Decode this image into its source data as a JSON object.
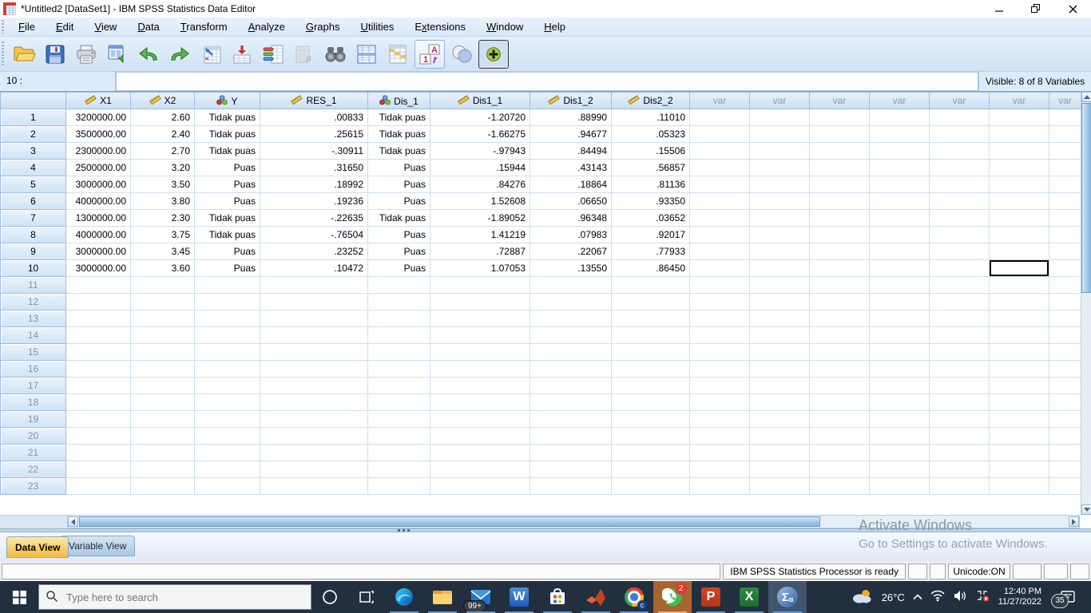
{
  "window": {
    "title": "*Untitled2 [DataSet1] - IBM SPSS Statistics Data Editor"
  },
  "menu": {
    "items": [
      {
        "label": "File",
        "mnemonic": 0
      },
      {
        "label": "Edit",
        "mnemonic": 0
      },
      {
        "label": "View",
        "mnemonic": 0
      },
      {
        "label": "Data",
        "mnemonic": 0
      },
      {
        "label": "Transform",
        "mnemonic": 0
      },
      {
        "label": "Analyze",
        "mnemonic": 0
      },
      {
        "label": "Graphs",
        "mnemonic": 0
      },
      {
        "label": "Utilities",
        "mnemonic": 0
      },
      {
        "label": "Extensions",
        "mnemonic": 1
      },
      {
        "label": "Window",
        "mnemonic": 0
      },
      {
        "label": "Help",
        "mnemonic": 0
      }
    ]
  },
  "toolbar": {
    "buttons": [
      {
        "name": "open-file-icon"
      },
      {
        "name": "save-icon"
      },
      {
        "name": "print-icon"
      },
      {
        "name": "recall-dialogs-icon"
      },
      {
        "name": "undo-icon"
      },
      {
        "name": "redo-icon"
      },
      {
        "name": "goto-case-icon"
      },
      {
        "name": "goto-variable-icon"
      },
      {
        "name": "variables-icon"
      },
      {
        "name": "descriptives-icon",
        "disabled": true
      },
      {
        "name": "find-icon"
      },
      {
        "name": "split-file-icon"
      },
      {
        "name": "select-cases-icon"
      },
      {
        "name": "value-labels-icon",
        "framed": true
      },
      {
        "name": "use-variable-sets-icon"
      },
      {
        "name": "show-all-variables-icon",
        "pressed": true
      }
    ]
  },
  "cell_reference": {
    "row_label": "10 :",
    "editor_value": "",
    "visible_info": "Visible: 8 of 8 Variables"
  },
  "grid": {
    "var_placeholder": "var",
    "columns": [
      {
        "name": "X1",
        "measure": "scale"
      },
      {
        "name": "X2",
        "measure": "scale"
      },
      {
        "name": "Y",
        "measure": "nominal"
      },
      {
        "name": "RES_1",
        "measure": "scale"
      },
      {
        "name": "Dis_1",
        "measure": "nominal"
      },
      {
        "name": "Dis1_1",
        "measure": "scale"
      },
      {
        "name": "Dis1_2",
        "measure": "scale"
      },
      {
        "name": "Dis2_2",
        "measure": "scale"
      }
    ],
    "rows": [
      {
        "n": "1",
        "values": [
          "3200000.00",
          "2.60",
          "Tidak puas",
          ".00833",
          "Tidak puas",
          "-1.20720",
          ".88990",
          ".11010"
        ]
      },
      {
        "n": "2",
        "values": [
          "3500000.00",
          "2.40",
          "Tidak puas",
          ".25615",
          "Tidak puas",
          "-1.66275",
          ".94677",
          ".05323"
        ]
      },
      {
        "n": "3",
        "values": [
          "2300000.00",
          "2.70",
          "Tidak puas",
          "-.30911",
          "Tidak puas",
          "-.97943",
          ".84494",
          ".15506"
        ]
      },
      {
        "n": "4",
        "values": [
          "2500000.00",
          "3.20",
          "Puas",
          ".31650",
          "Puas",
          ".15944",
          ".43143",
          ".56857"
        ]
      },
      {
        "n": "5",
        "values": [
          "3000000.00",
          "3.50",
          "Puas",
          ".18992",
          "Puas",
          ".84276",
          ".18864",
          ".81136"
        ]
      },
      {
        "n": "6",
        "values": [
          "4000000.00",
          "3.80",
          "Puas",
          ".19236",
          "Puas",
          "1.52608",
          ".06650",
          ".93350"
        ]
      },
      {
        "n": "7",
        "values": [
          "1300000.00",
          "2.30",
          "Tidak puas",
          "-.22635",
          "Tidak puas",
          "-1.89052",
          ".96348",
          ".03652"
        ]
      },
      {
        "n": "8",
        "values": [
          "4000000.00",
          "3.75",
          "Tidak puas",
          "-.76504",
          "Puas",
          "1.41219",
          ".07983",
          ".92017"
        ]
      },
      {
        "n": "9",
        "values": [
          "3000000.00",
          "3.45",
          "Puas",
          ".23252",
          "Puas",
          ".72887",
          ".22067",
          ".77933"
        ]
      },
      {
        "n": "10",
        "values": [
          "3000000.00",
          "3.60",
          "Puas",
          ".10472",
          "Puas",
          "1.07053",
          ".13550",
          ".86450"
        ]
      }
    ],
    "empty_row_start": 11,
    "empty_row_end": 23,
    "selected_cell": {
      "row": "10",
      "var_column": 6
    }
  },
  "tabs": {
    "data_view": "Data View",
    "variable_view": "Variable View",
    "active": "Data View"
  },
  "status_bar": {
    "processor": "IBM SPSS Statistics Processor is ready",
    "unicode": "Unicode:ON"
  },
  "watermark": {
    "line1": "Activate Windows",
    "line2": "Go to Settings to activate Windows."
  },
  "taskbar": {
    "search_placeholder": "Type here to search",
    "apps": [
      {
        "name": "edge-icon"
      },
      {
        "name": "file-explorer-icon"
      },
      {
        "name": "mail-icon",
        "badge": "99+"
      },
      {
        "name": "word-icon"
      },
      {
        "name": "microsoft-store-icon"
      },
      {
        "name": "matlab-icon"
      },
      {
        "name": "chrome-icon",
        "badge": "c"
      },
      {
        "name": "whatsapp-icon",
        "badge": "2",
        "highlighted": true
      },
      {
        "name": "powerpoint-icon"
      },
      {
        "name": "excel-icon"
      },
      {
        "name": "spss-icon",
        "active": true
      }
    ],
    "tray": {
      "temperature": "26°C",
      "time": "12:40 PM",
      "date": "11/27/2022",
      "notification_count": "35"
    }
  }
}
